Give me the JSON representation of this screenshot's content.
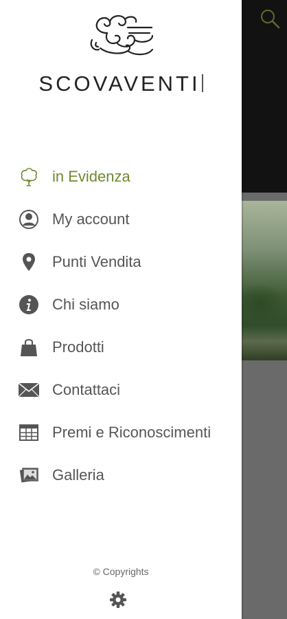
{
  "brand": {
    "name": "SCOVAVENTI"
  },
  "menu": [
    {
      "label": "in Evidenza",
      "icon": "tree-icon",
      "active": true
    },
    {
      "label": "My account",
      "icon": "user-icon",
      "active": false
    },
    {
      "label": "Punti Vendita",
      "icon": "location-pin-icon",
      "active": false
    },
    {
      "label": "Chi siamo",
      "icon": "info-icon",
      "active": false
    },
    {
      "label": "Prodotti",
      "icon": "shopping-bag-icon",
      "active": false
    },
    {
      "label": "Contattaci",
      "icon": "envelope-icon",
      "active": false
    },
    {
      "label": "Premi e Riconoscimenti",
      "icon": "table-icon",
      "active": false
    },
    {
      "label": "Galleria",
      "icon": "gallery-icon",
      "active": false
    }
  ],
  "footer": {
    "copyright": "© Copyrights",
    "settings_icon": "gear-icon"
  },
  "colors": {
    "accent": "#6e8a2e",
    "drawer_bg": "#ffffff",
    "text": "#555555",
    "overlay": "#6a6a6a"
  }
}
